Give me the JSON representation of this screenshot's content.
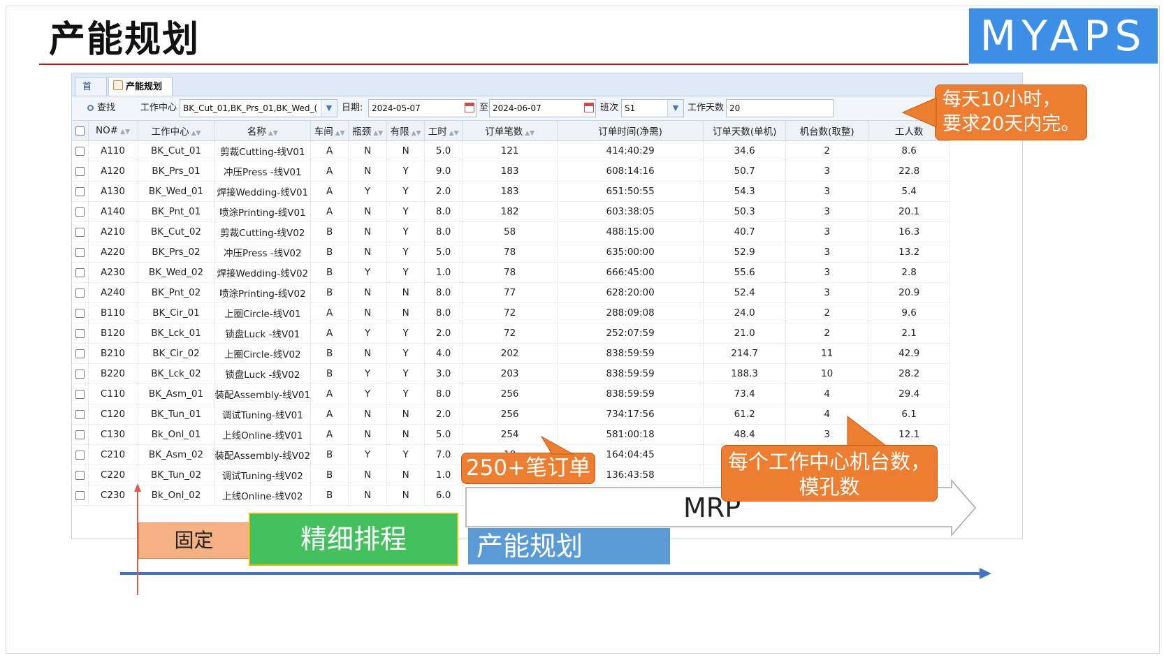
{
  "slide": {
    "title": "产能规划",
    "logo": "MYAPS"
  },
  "tabs": [
    {
      "label": "首页"
    },
    {
      "label": "产能规划",
      "close": "×"
    }
  ],
  "toolbar": {
    "search_label": "查找",
    "workcenter_label": "工作中心",
    "workcenter_value": "BK_Cut_01,BK_Prs_01,BK_Wed_(",
    "date_label": "日期:",
    "date_from": "2024-05-07",
    "date_to_label": "至",
    "date_to": "2024-06-07",
    "shift_label": "班次",
    "shift_value": "S1",
    "workdays_label": "工作天数",
    "workdays_value": "20"
  },
  "grid": {
    "columns": [
      "NO#",
      "工作中心",
      "名称",
      "车间",
      "瓶颈",
      "有限",
      "工时",
      "订单笔数",
      "订单时间(净需)",
      "订单天数(单机)",
      "机台数(取整)",
      "工人数"
    ],
    "rows": [
      [
        "A110",
        "BK_Cut_01",
        "剪裁Cutting-线V01",
        "A",
        "N",
        "N",
        "5.0",
        "121",
        "414:40:29",
        "34.6",
        "2",
        "8.6"
      ],
      [
        "A120",
        "BK_Prs_01",
        "冲压Press -线V01",
        "A",
        "N",
        "Y",
        "9.0",
        "183",
        "608:14:16",
        "50.7",
        "3",
        "22.8"
      ],
      [
        "A130",
        "BK_Wed_01",
        "焊接Wedding-线V01",
        "A",
        "Y",
        "Y",
        "2.0",
        "183",
        "651:50:55",
        "54.3",
        "3",
        "5.4"
      ],
      [
        "A140",
        "BK_Pnt_01",
        "喷涂Printing-线V01",
        "A",
        "N",
        "Y",
        "8.0",
        "182",
        "603:38:05",
        "50.3",
        "3",
        "20.1"
      ],
      [
        "A210",
        "BK_Cut_02",
        "剪裁Cutting-线V02",
        "B",
        "N",
        "Y",
        "8.0",
        "58",
        "488:15:00",
        "40.7",
        "3",
        "16.3"
      ],
      [
        "A220",
        "BK_Prs_02",
        "冲压Press -线V02",
        "B",
        "N",
        "Y",
        "5.0",
        "78",
        "635:00:00",
        "52.9",
        "3",
        "13.2"
      ],
      [
        "A230",
        "BK_Wed_02",
        "焊接Wedding-线V02",
        "B",
        "Y",
        "Y",
        "1.0",
        "78",
        "666:45:00",
        "55.6",
        "3",
        "2.8"
      ],
      [
        "A240",
        "BK_Pnt_02",
        "喷涂Printing-线V02",
        "B",
        "N",
        "N",
        "8.0",
        "77",
        "628:20:00",
        "52.4",
        "3",
        "20.9"
      ],
      [
        "B110",
        "BK_Cir_01",
        "上圈Circle-线V01",
        "A",
        "N",
        "N",
        "8.0",
        "72",
        "288:09:08",
        "24.0",
        "2",
        "9.6"
      ],
      [
        "B120",
        "BK_Lck_01",
        "锁盘Luck -线V01",
        "A",
        "Y",
        "Y",
        "2.0",
        "72",
        "252:07:59",
        "21.0",
        "2",
        "2.1"
      ],
      [
        "B210",
        "BK_Cir_02",
        "上圈Circle-线V02",
        "B",
        "N",
        "Y",
        "4.0",
        "202",
        "838:59:59",
        "214.7",
        "11",
        "42.9"
      ],
      [
        "B220",
        "BK_Lck_02",
        "锁盘Luck -线V02",
        "B",
        "Y",
        "Y",
        "3.0",
        "203",
        "838:59:59",
        "188.3",
        "10",
        "28.2"
      ],
      [
        "C110",
        "BK_Asm_01",
        "装配Assembly-线V01",
        "A",
        "Y",
        "Y",
        "8.0",
        "256",
        "838:59:59",
        "73.4",
        "4",
        "29.4"
      ],
      [
        "C120",
        "BK_Tun_01",
        "调试Tuning-线V01",
        "A",
        "N",
        "N",
        "2.0",
        "256",
        "734:17:56",
        "61.2",
        "4",
        "6.1"
      ],
      [
        "C130",
        "Bk_Onl_01",
        "上线Online-线V01",
        "A",
        "N",
        "N",
        "5.0",
        "254",
        "581:00:18",
        "48.4",
        "3",
        "12.1"
      ],
      [
        "C210",
        "BK_Asm_02",
        "装配Assembly-线V02",
        "B",
        "Y",
        "Y",
        "7.0",
        "18",
        "164:04:45",
        "",
        "",
        ""
      ],
      [
        "C220",
        "BK_Tun_02",
        "调试Tuning-线V02",
        "B",
        "N",
        "N",
        "1.0",
        "",
        "136:43:58",
        "",
        "",
        ""
      ],
      [
        "C230",
        "Bk_Onl_02",
        "上线Online-线V02",
        "B",
        "N",
        "N",
        "6.0",
        "",
        "",
        "",
        "",
        ""
      ]
    ]
  },
  "callouts": {
    "top_right": [
      "每天10小时，",
      "要求20天内完。"
    ],
    "orders": "250+笔订单",
    "machines": [
      "每个工作中心机台数，",
      "模孔数"
    ]
  },
  "timeline": {
    "fixed": "固定",
    "fine": "精细排程",
    "capacity": "产能规划",
    "mrp": "MRP"
  },
  "colors": {
    "accent_orange": "#ed7d31",
    "logo_blue": "#3d8fe6",
    "green": "#45c05e",
    "blue": "#5b9bd5",
    "axis": "#4472c4",
    "rule_red": "#b71c1c"
  }
}
